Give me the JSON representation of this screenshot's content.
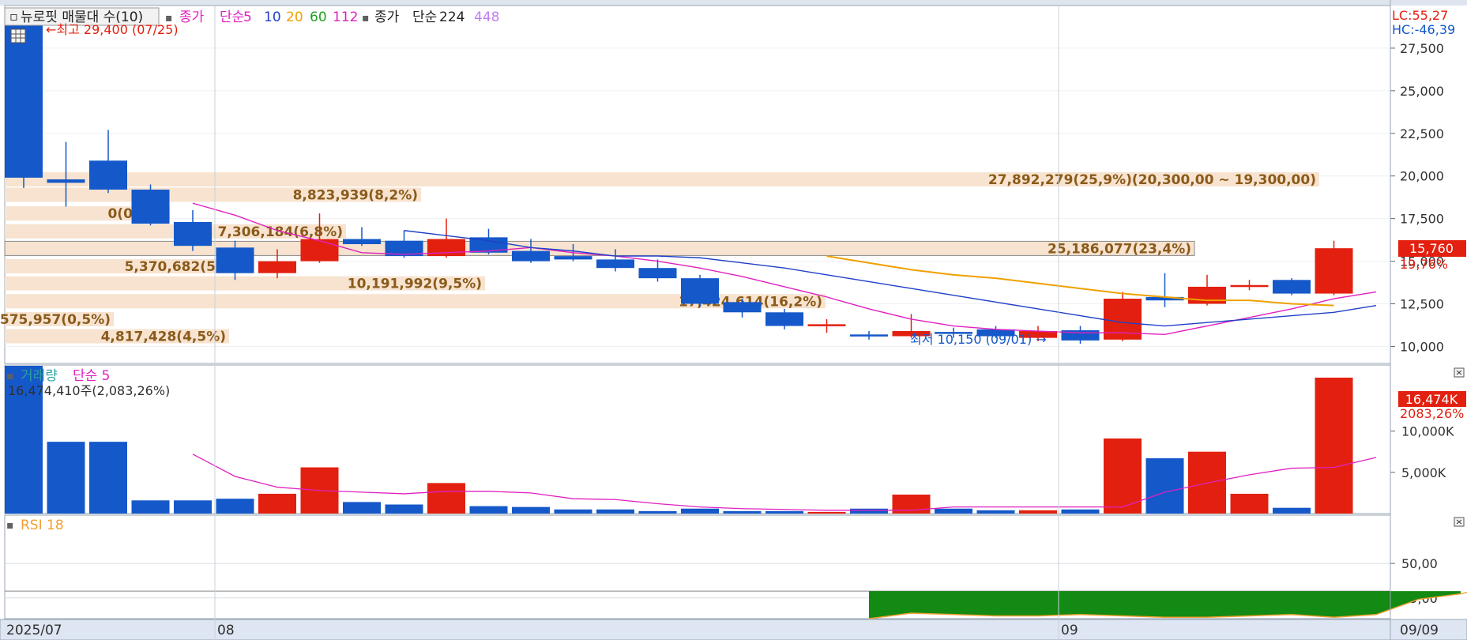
{
  "colors": {
    "up": "#e3200f",
    "down": "#1558c9",
    "ma5": "#e020c0",
    "ma10": "#2040c8",
    "ma20": "#f0a000",
    "ma60": "#20a020",
    "ma112": "#e020c0",
    "ma224": "#303030",
    "ma448": "#c080f0",
    "rsi": "#f0a030",
    "profile_band": "#f7e3cf",
    "profile_text": "#8a5a1a",
    "axis_bg": "#ffffff",
    "date_bar_bg": "#dde6f2"
  },
  "price_legend": {
    "title": "뉴로핏 매물대 수(10)",
    "close": "종가",
    "simple": "단순",
    "ma5": "5",
    "ma10": "10",
    "ma20": "20",
    "ma60": "60",
    "ma112": "112",
    "close2": "종가",
    "simple2": "단순",
    "ma224": "224",
    "ma448": "448"
  },
  "corner": {
    "lc": "LC:55,27",
    "hc": "HC:-46,39"
  },
  "high_annot": "←최고 29,400 (07/25)",
  "low_annot": "최저 10,150 (09/01) →",
  "current": {
    "price": "15,760",
    "change": "19,76%"
  },
  "volume_legend": {
    "title": "거래량",
    "ma": "단순 5",
    "value": "16,474,410주(2,083,26%)"
  },
  "volume_current": {
    "value": "16,474K",
    "pct": "2083,26%"
  },
  "rsi_legend": {
    "title": "RSI 18"
  },
  "x_labels": {
    "start": "2025/07",
    "aug": "08",
    "sep": "09",
    "end": "09/09"
  },
  "chart_data": [
    {
      "type": "candlestick",
      "title": "뉴로핏 매물대 수(10)",
      "ylim": [
        9000,
        30000
      ],
      "yticks": [
        10000,
        12500,
        15000,
        17500,
        20000,
        22500,
        25000,
        27500
      ],
      "ytick_labels": [
        "10,000",
        "12,500",
        "15,000",
        "17,500",
        "20,000",
        "22,500",
        "25,000",
        "27,500"
      ],
      "candles": [
        {
          "o": 28900,
          "h": 29400,
          "l": 19300,
          "c": 19900
        },
        {
          "o": 19800,
          "h": 22000,
          "l": 18200,
          "c": 19600
        },
        {
          "o": 20900,
          "h": 22700,
          "l": 19000,
          "c": 19200
        },
        {
          "o": 19200,
          "h": 19500,
          "l": 17100,
          "c": 17200
        },
        {
          "o": 17300,
          "h": 18000,
          "l": 15600,
          "c": 15900
        },
        {
          "o": 15800,
          "h": 16200,
          "l": 13900,
          "c": 14300
        },
        {
          "o": 14300,
          "h": 15700,
          "l": 14000,
          "c": 15000
        },
        {
          "o": 15000,
          "h": 17800,
          "l": 14900,
          "c": 16300
        },
        {
          "o": 16300,
          "h": 17000,
          "l": 15900,
          "c": 16000
        },
        {
          "o": 16200,
          "h": 16800,
          "l": 15200,
          "c": 15300
        },
        {
          "o": 15300,
          "h": 17500,
          "l": 15200,
          "c": 16300
        },
        {
          "o": 16400,
          "h": 16900,
          "l": 15400,
          "c": 15500
        },
        {
          "o": 15600,
          "h": 16300,
          "l": 14900,
          "c": 15000
        },
        {
          "o": 15300,
          "h": 16000,
          "l": 15000,
          "c": 15100
        },
        {
          "o": 15100,
          "h": 15700,
          "l": 14400,
          "c": 14600
        },
        {
          "o": 14600,
          "h": 15100,
          "l": 13800,
          "c": 14000
        },
        {
          "o": 14000,
          "h": 14200,
          "l": 12300,
          "c": 12500
        },
        {
          "o": 12600,
          "h": 12800,
          "l": 11700,
          "c": 12000
        },
        {
          "o": 12000,
          "h": 12200,
          "l": 11000,
          "c": 11200
        },
        {
          "o": 11200,
          "h": 11600,
          "l": 10800,
          "c": 11300
        },
        {
          "o": 10700,
          "h": 10900,
          "l": 10400,
          "c": 10600
        },
        {
          "o": 10600,
          "h": 11900,
          "l": 10500,
          "c": 10900
        },
        {
          "o": 10850,
          "h": 11100,
          "l": 10500,
          "c": 10800
        },
        {
          "o": 11000,
          "h": 11200,
          "l": 10500,
          "c": 10600
        },
        {
          "o": 10500,
          "h": 11200,
          "l": 10300,
          "c": 10900
        },
        {
          "o": 10950,
          "h": 11200,
          "l": 10150,
          "c": 10350
        },
        {
          "o": 10400,
          "h": 13200,
          "l": 10300,
          "c": 12800
        },
        {
          "o": 12900,
          "h": 14300,
          "l": 12300,
          "c": 12700
        },
        {
          "o": 12500,
          "h": 14200,
          "l": 12400,
          "c": 13500
        },
        {
          "o": 13500,
          "h": 13900,
          "l": 13300,
          "c": 13600
        },
        {
          "o": 13900,
          "h": 14000,
          "l": 13000,
          "c": 13100
        },
        {
          "o": 13100,
          "h": 16200,
          "l": 13000,
          "c": 15760
        }
      ],
      "series": [
        {
          "name": "5",
          "start": 4,
          "values": [
            18400,
            17700,
            16800,
            16200,
            15500,
            15400,
            15500,
            15600,
            15800,
            15500,
            15300,
            15000,
            14600,
            14100,
            13500,
            12900,
            12200,
            11600,
            11200,
            11000,
            10900,
            10800,
            10800,
            10700,
            11200,
            11700,
            12200,
            12800,
            13200
          ]
        },
        {
          "name": "10",
          "start": 9,
          "values": [
            16800,
            16500,
            16200,
            15800,
            15600,
            15300,
            15300,
            15200,
            14900,
            14600,
            14200,
            13800,
            13400,
            13000,
            12600,
            12200,
            11800,
            11400,
            11200,
            11400,
            11600,
            11800,
            12000,
            12400
          ]
        },
        {
          "name": "20",
          "start": 19,
          "values": [
            15300,
            14900,
            14500,
            14200,
            14000,
            13700,
            13400,
            13100,
            12900,
            12700,
            12700,
            12500,
            12400
          ]
        }
      ],
      "volume_profile": [
        {
          "label": "27,892,279(25,9%)(20,300,00 ~ 19,300,00)",
          "price": 19800
        },
        {
          "label": "8,823,939(8,2%)",
          "price": 18900
        },
        {
          "label": "0(0,0%)",
          "price": 17800
        },
        {
          "label": "7,306,184(6,8%)",
          "price": 16750
        },
        {
          "label": "25,186,077(23,4%)",
          "price": 15750
        },
        {
          "label": "5,370,682(5,0%)",
          "price": 14700
        },
        {
          "label": "10,191,992(9,5%)",
          "price": 13700
        },
        {
          "label": "17,424,614(16,2%)",
          "price": 12650
        },
        {
          "label": "575,957(0,5%)",
          "price": 11600
        },
        {
          "label": "4,817,428(4,5%)",
          "price": 10600
        }
      ]
    },
    {
      "type": "bar",
      "title": "거래량",
      "ylim": [
        0,
        18000
      ],
      "yticks": [
        5000,
        10000
      ],
      "ytick_labels": [
        "5,000K",
        "10,000K"
      ],
      "values": [
        18500,
        8700,
        8700,
        1600,
        1600,
        1800,
        2400,
        5600,
        1400,
        1100,
        3700,
        900,
        800,
        500,
        500,
        300,
        600,
        300,
        300,
        200,
        600,
        2300,
        600,
        400,
        400,
        500,
        9100,
        6700,
        7500,
        2400,
        700,
        16474
      ],
      "ma": {
        "name": "단순 5",
        "start": 4,
        "values": [
          7200,
          4500,
          3200,
          2800,
          2600,
          2400,
          2700,
          2700,
          2500,
          1800,
          1700,
          1200,
          800,
          600,
          500,
          400,
          400,
          400,
          800,
          800,
          800,
          800,
          800,
          2600,
          3700,
          4700,
          5500,
          5600,
          6800
        ]
      }
    },
    {
      "type": "line",
      "title": "RSI 18",
      "ylim": [
        10,
        85
      ],
      "yticks": [
        25,
        50
      ],
      "ytick_labels": [
        "25,00",
        "50,00"
      ],
      "baseline": 30,
      "start": 20,
      "values": [
        10,
        14,
        13,
        12,
        12,
        13,
        12,
        11,
        11,
        12,
        13,
        11,
        13,
        24,
        28,
        35,
        35,
        38,
        40,
        41,
        40,
        40,
        40,
        40
      ]
    }
  ]
}
